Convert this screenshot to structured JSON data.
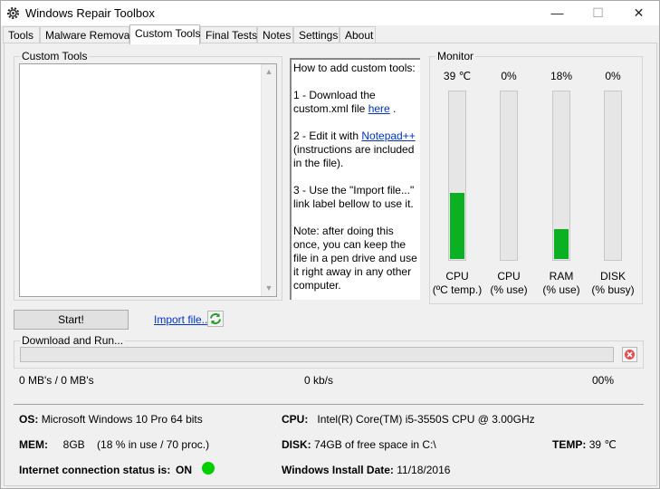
{
  "window": {
    "title": "Windows Repair Toolbox",
    "minimize_glyph": "—",
    "maximize_glyph": "☐",
    "close_glyph": "✕"
  },
  "tabs": [
    {
      "label": "Tools"
    },
    {
      "label": "Malware Removal"
    },
    {
      "label": "Custom Tools"
    },
    {
      "label": "Final Tests"
    },
    {
      "label": "Notes"
    },
    {
      "label": "Settings"
    },
    {
      "label": "About"
    }
  ],
  "active_tab": "Custom Tools",
  "custom_tools": {
    "group_label": "Custom Tools",
    "list_items": []
  },
  "instructions": {
    "p1": "How to add custom tools:",
    "p2_prefix": "1 - Download the custom.xml file ",
    "p2_link": "here",
    "p2_suffix": " .",
    "p3_prefix": "2 - Edit it with ",
    "p3_link": "Notepad++",
    "p3_suffix": " (instructions are included in the file).",
    "p4": "3 - Use the \"Import file...\" link label bellow to use it.",
    "p5": "Note: after doing this once, you can keep the file in a pen drive and use it right away in any other computer."
  },
  "monitor": {
    "group_label": "Monitor",
    "gauges": [
      {
        "value_text": "39 ℃",
        "level": 0.39,
        "label": "CPU",
        "sub": "(ºC temp.)"
      },
      {
        "value_text": "0%",
        "level": 0,
        "label": "CPU",
        "sub": "(% use)"
      },
      {
        "value_text": "18%",
        "level": 0.18,
        "label": "RAM",
        "sub": "(% use)"
      },
      {
        "value_text": "0%",
        "level": 0,
        "label": "DISK",
        "sub": "(% busy)"
      }
    ],
    "fill_color": "#0cb023"
  },
  "actions": {
    "start_label": "Start!",
    "import_label": "Import file..."
  },
  "download": {
    "group_label": "Download and Run...",
    "progress_fraction": 0,
    "mb_text": "0 MB's / 0 MB's",
    "speed_text": "0 kb/s",
    "percent_text": "00%"
  },
  "system": {
    "os_label": "OS:",
    "os_value": "Microsoft Windows 10 Pro 64 bits",
    "cpu_label": "CPU:",
    "cpu_value": "Intel(R) Core(TM) i5-3550S CPU @ 3.00GHz",
    "mem_label": "MEM:",
    "mem_value": "8GB",
    "mem_detail": "(18 % in use / 70 proc.)",
    "disk_label": "DISK:",
    "disk_value": "74GB of free space in C:\\",
    "temp_label": "TEMP:",
    "temp_value": "39 ℃",
    "internet_label": "Internet connection status is:",
    "internet_value": "ON",
    "install_label": "Windows Install Date:",
    "install_value": "11/18/2016",
    "status_color": "#00d000"
  }
}
